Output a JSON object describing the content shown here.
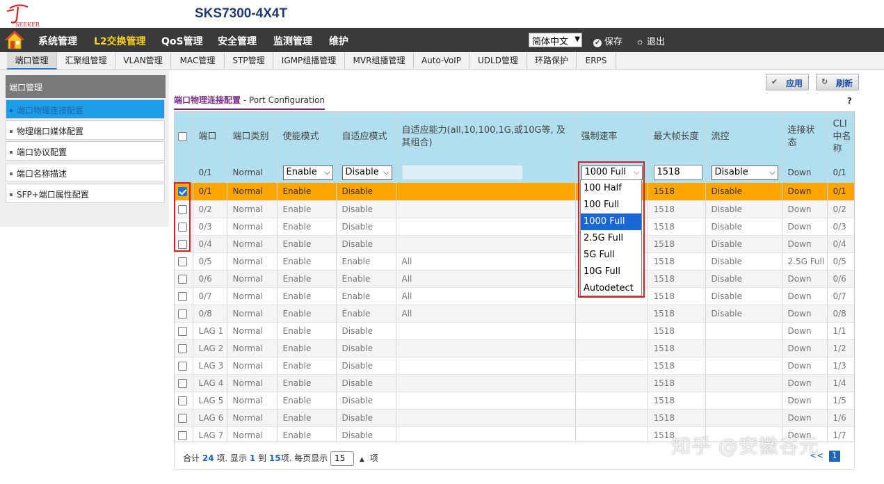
{
  "app": {
    "model": "SKS7300-4X4T",
    "logo_text": "SEEKER"
  },
  "main_nav": {
    "items": [
      "系统管理",
      "L2交换管理",
      "QoS管理",
      "安全管理",
      "监测管理",
      "维护"
    ],
    "active_index": 1,
    "language": "简体中文",
    "save_label": "保存",
    "logout_label": "退出"
  },
  "sub_nav": {
    "items": [
      "端口管理",
      "汇聚组管理",
      "VLAN管理",
      "MAC管理",
      "STP管理",
      "IGMP组播管理",
      "MVR组播管理",
      "Auto-VoIP",
      "UDLD管理",
      "环路保护",
      "ERPS"
    ],
    "active_index": 0
  },
  "sidebar": {
    "title": "端口管理",
    "items": [
      "端口物理连接配置",
      "物理端口媒体配置",
      "端口协议配置",
      "端口名称描述",
      "SFP+端口属性配置"
    ],
    "active_index": 0
  },
  "content": {
    "title_cn": "端口物理连接配置",
    "title_en": "- Port Configuration",
    "help": "?",
    "apply_label": "应用",
    "refresh_label": "刷新"
  },
  "table": {
    "headers": [
      "端口",
      "端口类别",
      "使能模式",
      "自适应模式",
      "自适应能力(all,10,100,1G,或10G等, 及其组合)",
      "强制速率",
      "最大帧长度",
      "流控",
      "连接状态",
      "CLI中名称"
    ],
    "edit_row": {
      "port": "0/1",
      "type": "Normal",
      "admin": "Enable",
      "auto": "Disable",
      "capability": "",
      "speed": "1000 Full",
      "mtu": "1518",
      "flow": "Disable",
      "link": "Down",
      "cli": "0/1"
    },
    "rows": [
      {
        "checked": true,
        "port": "0/1",
        "type": "Normal",
        "admin": "Enable",
        "auto": "Disable",
        "capability": "",
        "speed": "",
        "mtu": "1518",
        "flow": "Disable",
        "link": "Down",
        "cli": "0/1"
      },
      {
        "checked": false,
        "port": "0/2",
        "type": "Normal",
        "admin": "Enable",
        "auto": "Disable",
        "capability": "",
        "speed": "",
        "mtu": "1518",
        "flow": "Disable",
        "link": "Down",
        "cli": "0/2"
      },
      {
        "checked": false,
        "port": "0/3",
        "type": "Normal",
        "admin": "Enable",
        "auto": "Disable",
        "capability": "",
        "speed": "",
        "mtu": "1518",
        "flow": "Disable",
        "link": "Down",
        "cli": "0/3"
      },
      {
        "checked": false,
        "port": "0/4",
        "type": "Normal",
        "admin": "Enable",
        "auto": "Disable",
        "capability": "",
        "speed": "",
        "mtu": "1518",
        "flow": "Disable",
        "link": "Down",
        "cli": "0/4"
      },
      {
        "checked": false,
        "port": "0/5",
        "type": "Normal",
        "admin": "Enable",
        "auto": "Enable",
        "capability": "All",
        "speed": "",
        "mtu": "1518",
        "flow": "Disable",
        "link": "2.5G Full",
        "cli": "0/5"
      },
      {
        "checked": false,
        "port": "0/6",
        "type": "Normal",
        "admin": "Enable",
        "auto": "Enable",
        "capability": "All",
        "speed": "",
        "mtu": "1518",
        "flow": "Disable",
        "link": "Down",
        "cli": "0/6"
      },
      {
        "checked": false,
        "port": "0/7",
        "type": "Normal",
        "admin": "Enable",
        "auto": "Enable",
        "capability": "All",
        "speed": "",
        "mtu": "1518",
        "flow": "Disable",
        "link": "Down",
        "cli": "0/7"
      },
      {
        "checked": false,
        "port": "0/8",
        "type": "Normal",
        "admin": "Enable",
        "auto": "Enable",
        "capability": "All",
        "speed": "",
        "mtu": "1518",
        "flow": "Disable",
        "link": "Down",
        "cli": "0/8"
      },
      {
        "checked": false,
        "port": "LAG 1",
        "type": "Normal",
        "admin": "Enable",
        "auto": "Disable",
        "capability": "",
        "speed": "",
        "mtu": "1518",
        "flow": "",
        "link": "Down",
        "cli": "1/1"
      },
      {
        "checked": false,
        "port": "LAG 2",
        "type": "Normal",
        "admin": "Enable",
        "auto": "Disable",
        "capability": "",
        "speed": "",
        "mtu": "1518",
        "flow": "",
        "link": "Down",
        "cli": "1/2"
      },
      {
        "checked": false,
        "port": "LAG 3",
        "type": "Normal",
        "admin": "Enable",
        "auto": "Disable",
        "capability": "",
        "speed": "",
        "mtu": "1518",
        "flow": "",
        "link": "Down",
        "cli": "1/3"
      },
      {
        "checked": false,
        "port": "LAG 4",
        "type": "Normal",
        "admin": "Enable",
        "auto": "Disable",
        "capability": "",
        "speed": "",
        "mtu": "1518",
        "flow": "",
        "link": "Down",
        "cli": "1/4"
      },
      {
        "checked": false,
        "port": "LAG 5",
        "type": "Normal",
        "admin": "Enable",
        "auto": "Disable",
        "capability": "",
        "speed": "",
        "mtu": "1518",
        "flow": "",
        "link": "Down",
        "cli": "1/5"
      },
      {
        "checked": false,
        "port": "LAG 6",
        "type": "Normal",
        "admin": "Enable",
        "auto": "Disable",
        "capability": "",
        "speed": "",
        "mtu": "1518",
        "flow": "",
        "link": "Down",
        "cli": "1/6"
      },
      {
        "checked": false,
        "port": "LAG 7",
        "type": "Normal",
        "admin": "Enable",
        "auto": "Disable",
        "capability": "",
        "speed": "",
        "mtu": "1518",
        "flow": "",
        "link": "Down",
        "cli": "1/7"
      }
    ]
  },
  "speed_dropdown": {
    "options": [
      "100 Half",
      "100 Full",
      "1000 Full",
      "2.5G Full",
      "5G Full",
      "10G Full",
      "Autodetect"
    ],
    "highlighted_index": 2
  },
  "footer": {
    "prefix": "合计",
    "total": "24",
    "mid1": "项. 显示",
    "from": "1",
    "mid2": "到",
    "to": "15",
    "mid3": "项. 每页显示",
    "page_size": "15",
    "suffix": "项",
    "pager_prev": "<<",
    "pager_current": "1"
  },
  "watermark": "知乎 @安徽谷元",
  "colors": {
    "nav_bg": "#3a3a3a",
    "nav_active": "#f5d020",
    "header_blue": "#b2dfee",
    "selected_row": "#ffa500",
    "accent_purple": "#7b2d8b",
    "highlight_red": "#d42020"
  }
}
